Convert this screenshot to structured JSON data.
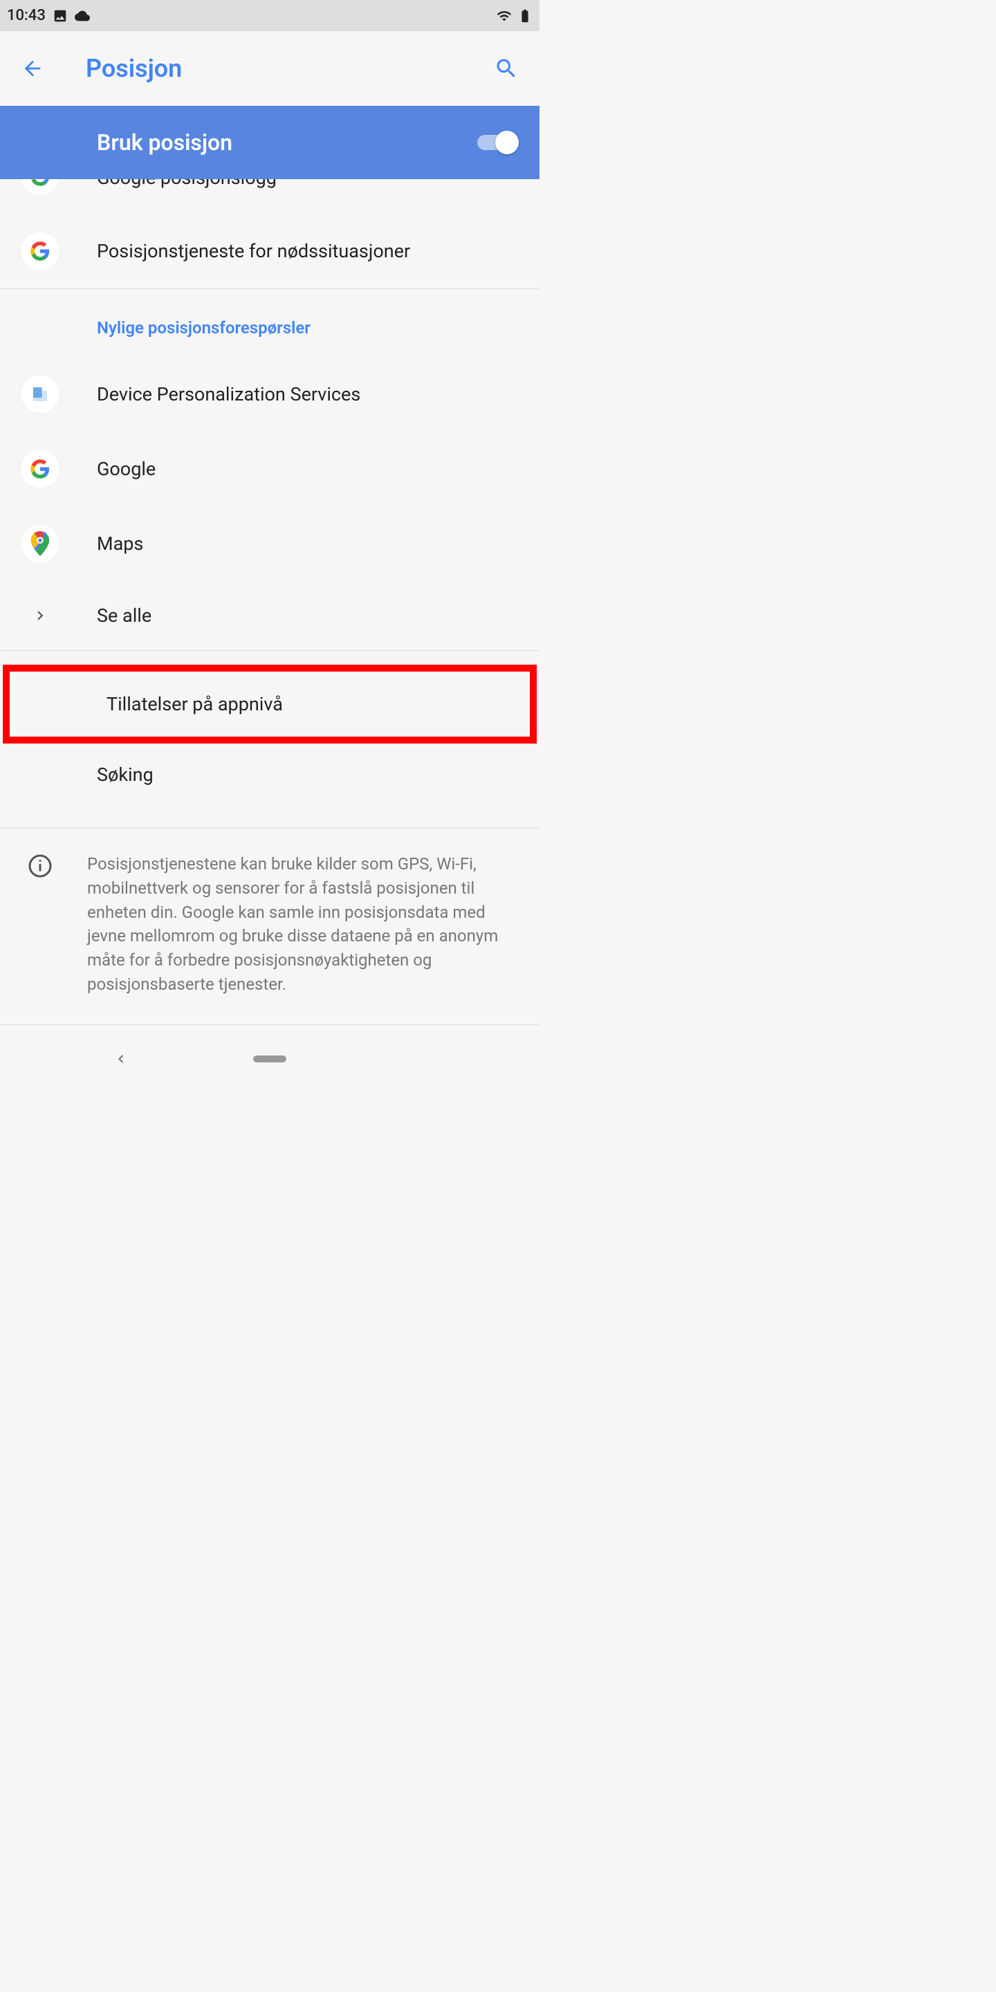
{
  "status": {
    "time": "10:43"
  },
  "header": {
    "title": "Posisjon"
  },
  "toggle": {
    "label": "Bruk posisjon"
  },
  "history_items": [
    {
      "name": "Google posisjonslogg"
    },
    {
      "name": "Posisjonstjeneste for nødssituasjoner"
    }
  ],
  "recent": {
    "header": "Nylige posisjonsforespørsler",
    "apps": [
      {
        "name": "Device Personalization Services"
      },
      {
        "name": "Google"
      },
      {
        "name": "Maps"
      }
    ],
    "see_all": "Se alle"
  },
  "settings": {
    "app_level": "Tillatelser på appnivå",
    "scanning": "Søking"
  },
  "info": {
    "text": "Posisjonstjenestene kan bruke kilder som GPS, Wi-Fi, mobilnettverk og sensorer for å fastslå posisjonen til enheten din. Google kan samle inn posisjonsdata med jevne mellomrom og bruke disse dataene på en anonym måte for å forbedre posisjonsnøyaktigheten og posisjonsbaserte tjenester."
  }
}
